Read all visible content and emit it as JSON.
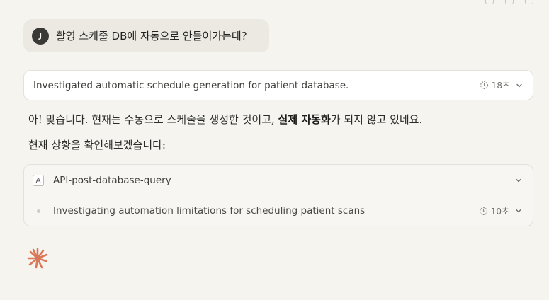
{
  "user_message": {
    "avatar_initial": "J",
    "text": "촬영 스케줄 DB에 자동으로 안들어가는데?"
  },
  "thinking": {
    "summary": "Investigated automatic schedule generation for patient database.",
    "duration": "18초"
  },
  "response": {
    "p1_a": "아! 맞습니다. 현재는 수동으로 스케줄을 생성한 것이고, ",
    "p1_bold": "실제 자동화",
    "p1_b": "가 되지 않고 있네요.",
    "p2": "현재 상황을 확인해보겠습니다:"
  },
  "tool": {
    "badge": "A",
    "name": "API-post-database-query",
    "step_text": "Investigating automation limitations for scheduling patient scans",
    "step_duration": "10초"
  },
  "colors": {
    "background": "#f5f4ef",
    "accent_spark": "#d97757"
  }
}
